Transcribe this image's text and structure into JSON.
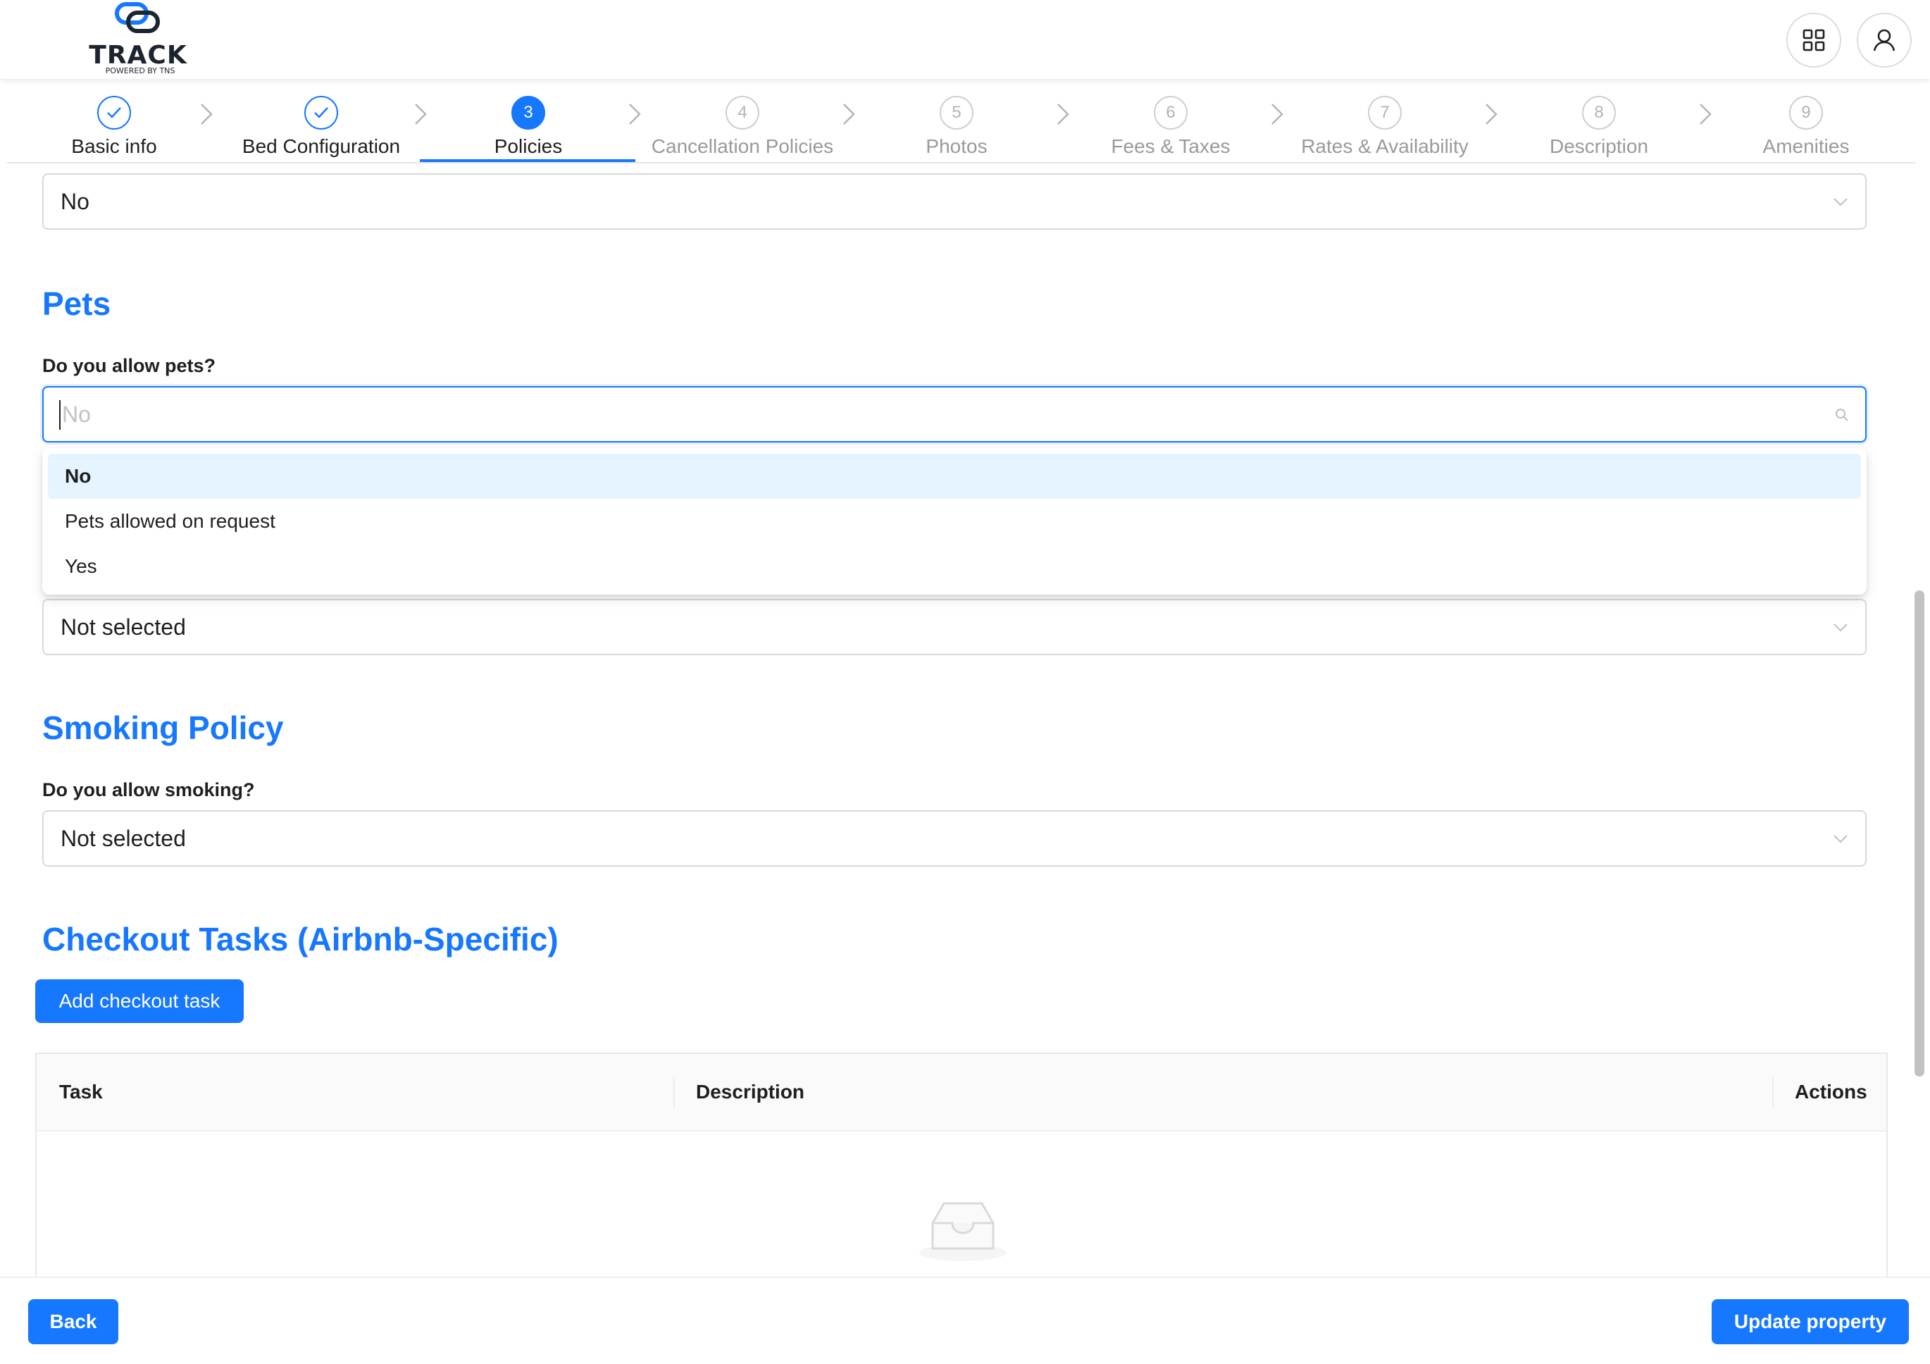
{
  "app": {
    "logo_text": "TRACK",
    "logo_sub": "POWERED BY TNS",
    "brand_color": "#1677ff"
  },
  "header": {
    "apps_icon": "grid-icon",
    "user_icon": "user-icon"
  },
  "steps": [
    {
      "num": "1",
      "label": "Basic info",
      "status": "done"
    },
    {
      "num": "2",
      "label": "Bed Configuration",
      "status": "done"
    },
    {
      "num": "3",
      "label": "Policies",
      "status": "active"
    },
    {
      "num": "4",
      "label": "Cancellation Policies",
      "status": "pending"
    },
    {
      "num": "5",
      "label": "Photos",
      "status": "pending"
    },
    {
      "num": "6",
      "label": "Fees & Taxes",
      "status": "pending"
    },
    {
      "num": "7",
      "label": "Rates & Availability",
      "status": "pending"
    },
    {
      "num": "8",
      "label": "Description",
      "status": "pending"
    },
    {
      "num": "9",
      "label": "Amenities",
      "status": "pending"
    }
  ],
  "top_select": {
    "value": "No"
  },
  "pets": {
    "title": "Pets",
    "question": "Do you allow pets?",
    "search_placeholder": "No",
    "options": [
      {
        "label": "No",
        "selected": true
      },
      {
        "label": "Pets allowed on request",
        "selected": false
      },
      {
        "label": "Yes",
        "selected": false
      }
    ],
    "secondary_select_value": "Not selected"
  },
  "smoking": {
    "title": "Smoking Policy",
    "question": "Do you allow smoking?",
    "value": "Not selected"
  },
  "checkout": {
    "title": "Checkout Tasks (Airbnb-Specific)",
    "add_button": "Add checkout task",
    "columns": [
      "Task",
      "Description",
      "Actions"
    ],
    "rows": []
  },
  "footer": {
    "back": "Back",
    "update": "Update property"
  }
}
